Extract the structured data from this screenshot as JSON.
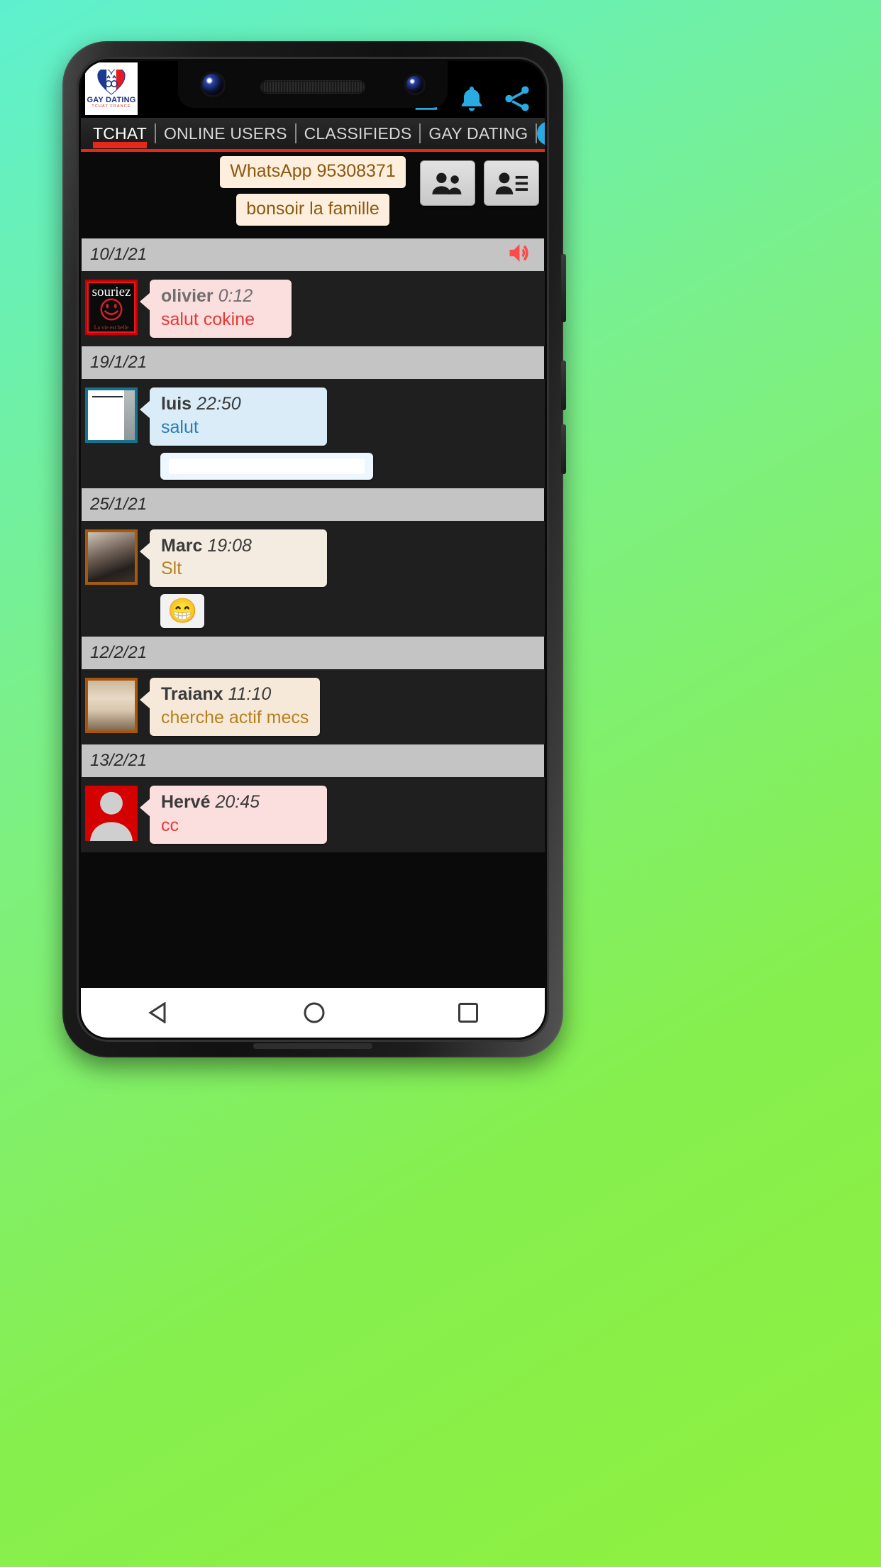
{
  "app": {
    "logo": {
      "title": "GAY DATING",
      "subtitle": "TCHAT FRANCE",
      "icon": "heart-flag-logo"
    },
    "header_icons": [
      {
        "name": "profile-icon",
        "label": "Profile"
      },
      {
        "name": "bell-icon",
        "label": "Notifications"
      },
      {
        "name": "share-icon",
        "label": "Share"
      }
    ],
    "accent_red": "#e8271b",
    "accent_blue": "#29abe2"
  },
  "tabs": [
    {
      "label": "TCHAT",
      "active": true
    },
    {
      "label": "ONLINE USERS",
      "active": false
    },
    {
      "label": "CLASSIFIEDS",
      "active": false
    },
    {
      "label": "GAY DATING",
      "active": false
    }
  ],
  "pinned": {
    "messages": [
      "WhatsApp 95308371",
      "bonsoir la famille"
    ],
    "actions": [
      {
        "name": "users-group-button",
        "icon": "two-people-icon"
      },
      {
        "name": "user-list-button",
        "icon": "person-list-icon"
      }
    ]
  },
  "speaker_toggle": {
    "name": "sound-icon",
    "color": "#ff4a4a"
  },
  "conversation": [
    {
      "date": "10/1/21",
      "has_speaker_icon": true,
      "messages": [
        {
          "name": "olivier",
          "time": "0:12",
          "text": "salut cokine",
          "bubble_bg": "#fbdede",
          "name_color": "#6f6f6f",
          "text_color": "#e53935",
          "avatar": {
            "type": "souriez",
            "caption_top": "souriez",
            "caption_bottom": "La vie est belle"
          }
        }
      ]
    },
    {
      "date": "19/1/21",
      "has_speaker_icon": false,
      "messages": [
        {
          "name": "luis",
          "time": "22:50",
          "text": "salut",
          "bubble_bg": "#d9ecf7",
          "name_color": "#3a3a3a",
          "text_color": "#2b7db5",
          "avatar": {
            "type": "photo-blue"
          },
          "attachment": "image-thumbnail"
        }
      ]
    },
    {
      "date": "25/1/21",
      "has_speaker_icon": false,
      "messages": [
        {
          "name": "Marc",
          "time": "19:08",
          "text": "Slt",
          "bubble_bg": "#f4ece1",
          "name_color": "#3a3a3a",
          "text_color": "#b5821f",
          "avatar": {
            "type": "photo-orange"
          },
          "reaction": "😁"
        }
      ]
    },
    {
      "date": "12/2/21",
      "has_speaker_icon": false,
      "messages": [
        {
          "name": "Traianx",
          "time": "11:10",
          "text": "cherche actif mecs",
          "bubble_bg": "#f6e9da",
          "name_color": "#3a3a3a",
          "text_color": "#b5821f",
          "avatar": {
            "type": "photo-brown"
          }
        }
      ]
    },
    {
      "date": "13/2/21",
      "has_speaker_icon": false,
      "messages": [
        {
          "name": "Hervé",
          "time": "20:45",
          "text": "cc",
          "bubble_bg": "#fbdede",
          "name_color": "#3a3a3a",
          "text_color": "#e53935",
          "avatar": {
            "type": "placeholder-red"
          }
        }
      ]
    }
  ],
  "nav_bar": [
    {
      "name": "nav-back-button",
      "icon": "triangle-back-icon"
    },
    {
      "name": "nav-home-button",
      "icon": "circle-home-icon"
    },
    {
      "name": "nav-recents-button",
      "icon": "square-recents-icon"
    }
  ]
}
